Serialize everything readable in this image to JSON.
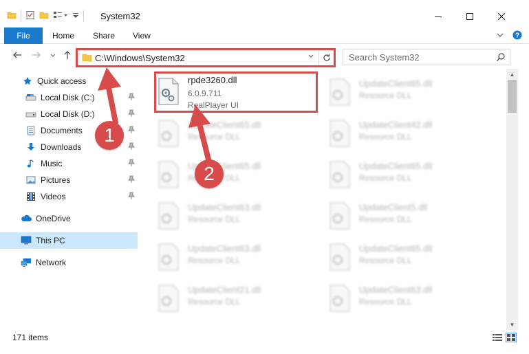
{
  "window": {
    "title": "System32"
  },
  "ribbon": {
    "tabs": [
      "File",
      "Home",
      "Share",
      "View"
    ]
  },
  "address": {
    "path": "C:\\Windows\\System32"
  },
  "search": {
    "placeholder": "Search System32"
  },
  "sidebar": {
    "items": [
      {
        "label": "Quick access",
        "icon": "star-icon",
        "pinned": false
      },
      {
        "label": "Local Disk (C:)",
        "icon": "drive-icon",
        "pinned": true
      },
      {
        "label": "Local Disk (D:)",
        "icon": "drive-icon",
        "pinned": true
      },
      {
        "label": "Documents",
        "icon": "documents-icon",
        "pinned": true
      },
      {
        "label": "Downloads",
        "icon": "download-icon",
        "pinned": true
      },
      {
        "label": "Music",
        "icon": "music-icon",
        "pinned": true
      },
      {
        "label": "Pictures",
        "icon": "pictures-icon",
        "pinned": true
      },
      {
        "label": "Videos",
        "icon": "videos-icon",
        "pinned": true
      },
      {
        "label": "OneDrive",
        "icon": "cloud-icon",
        "pinned": false
      },
      {
        "label": "This PC",
        "icon": "computer-icon",
        "pinned": false,
        "selected": true
      },
      {
        "label": "Network",
        "icon": "network-icon",
        "pinned": false
      }
    ]
  },
  "files": {
    "highlighted": {
      "name": "rpde3260.dll",
      "version": "6.0.9.711",
      "description": "RealPlayer UI"
    },
    "blurred": [
      {
        "name": "UpdateClient65.dll",
        "sub": "Resource DLL"
      },
      {
        "name": "UpdateClient65.dll",
        "sub": "Resource DLL"
      },
      {
        "name": "UpdateClient42.dll",
        "sub": "Resource DLL"
      },
      {
        "name": "UpdateClient65.dll",
        "sub": "Resource DLL"
      },
      {
        "name": "UpdateClient65.dll",
        "sub": "Resource DLL"
      },
      {
        "name": "UpdateClient63.dll",
        "sub": "Resource DLL"
      },
      {
        "name": "UpdateClient5.dll",
        "sub": "Resource DLL"
      },
      {
        "name": "UpdateClient63.dll",
        "sub": "Resource DLL"
      },
      {
        "name": "UpdateClient65.dll",
        "sub": "Resource DLL"
      },
      {
        "name": "UpdateClient21.dll",
        "sub": "Resource DLL"
      },
      {
        "name": "UpdateClient63.dll",
        "sub": "Resource DLL"
      }
    ]
  },
  "status": {
    "item_count": "171 items"
  },
  "annotations": {
    "step1": "1",
    "step2": "2"
  },
  "colors": {
    "accent": "#1979ca",
    "annotation": "#d84b4b",
    "selected": "#cce8ff"
  }
}
